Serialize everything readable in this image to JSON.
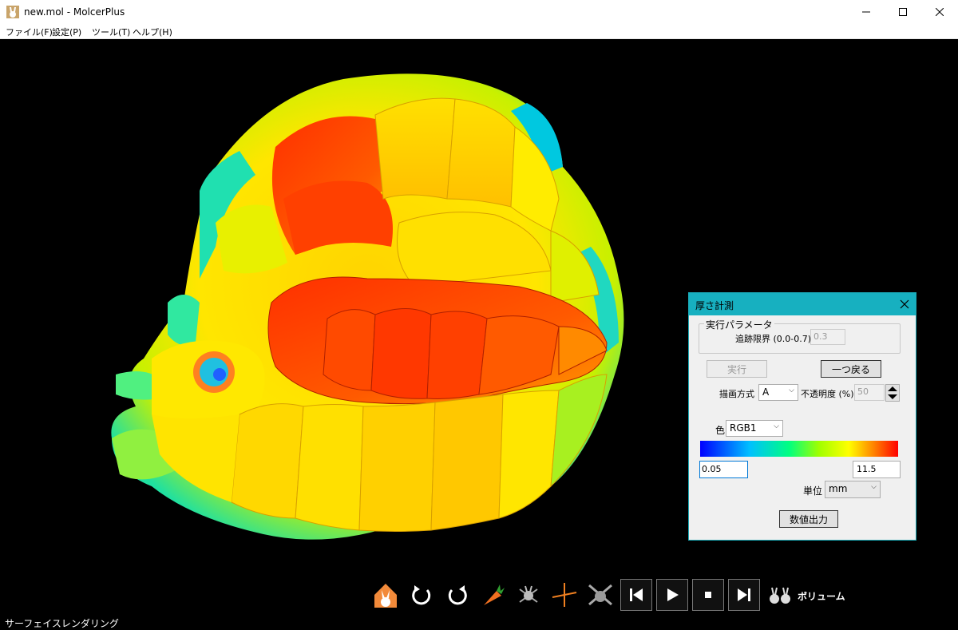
{
  "window": {
    "title": "new.mol - MolcerPlus"
  },
  "menu": [
    "ファイル(F)",
    "設定(P)",
    "ツール(T)",
    "ヘルプ(H)"
  ],
  "viewport": {
    "render_mode": "サーフェイスレンダリング"
  },
  "toolbar": {
    "volume_label": "ボリューム"
  },
  "dialog": {
    "title": "厚さ計測",
    "group_label": "実行パラメータ",
    "trace_limit_label": "追跡限界 (0.0-0.7)",
    "trace_limit_value": "0.3",
    "run_button": "実行",
    "back_button": "一つ戻る",
    "draw_mode_label": "描画方式",
    "draw_mode_value": "A",
    "opacity_label": "不透明度 (%)",
    "opacity_value": "50",
    "color_label": "色",
    "color_value": "RGB1",
    "range_min": "0.05",
    "range_max": "11.5",
    "unit_label": "単位",
    "unit_value": "mm",
    "export_button": "数値出力"
  },
  "colors": {
    "dialog_title_bar": "#17b0c0",
    "viewport_bg": "#000000"
  }
}
